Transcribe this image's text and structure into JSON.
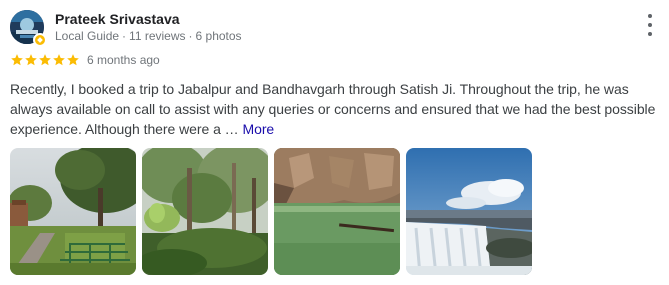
{
  "reviewer": {
    "name": "Prateek Srivastava",
    "badge": "Local Guide",
    "separator": "·",
    "reviews": "11 reviews",
    "photos": "6 photos"
  },
  "rating": {
    "stars": 5,
    "max": 5,
    "star_color": "#fbbc04"
  },
  "time_ago": "6 months ago",
  "review": {
    "text": "Recently, I booked a trip to Jabalpur and Bandhavgarh through Satish Ji. Throughout the trip, he was always available on call to assist with any queries or concerns and ensured that we had the best possible experience. Although there were a … ",
    "more_label": "More"
  },
  "photos": [
    {
      "icon": "park-garden-photo"
    },
    {
      "icon": "forest-trees-photo"
    },
    {
      "icon": "river-rocks-photo"
    },
    {
      "icon": "waterfall-photo"
    }
  ],
  "colors": {
    "name": "#202124",
    "meta": "#70757a",
    "link": "#1a0dab",
    "star": "#fbbc04"
  }
}
